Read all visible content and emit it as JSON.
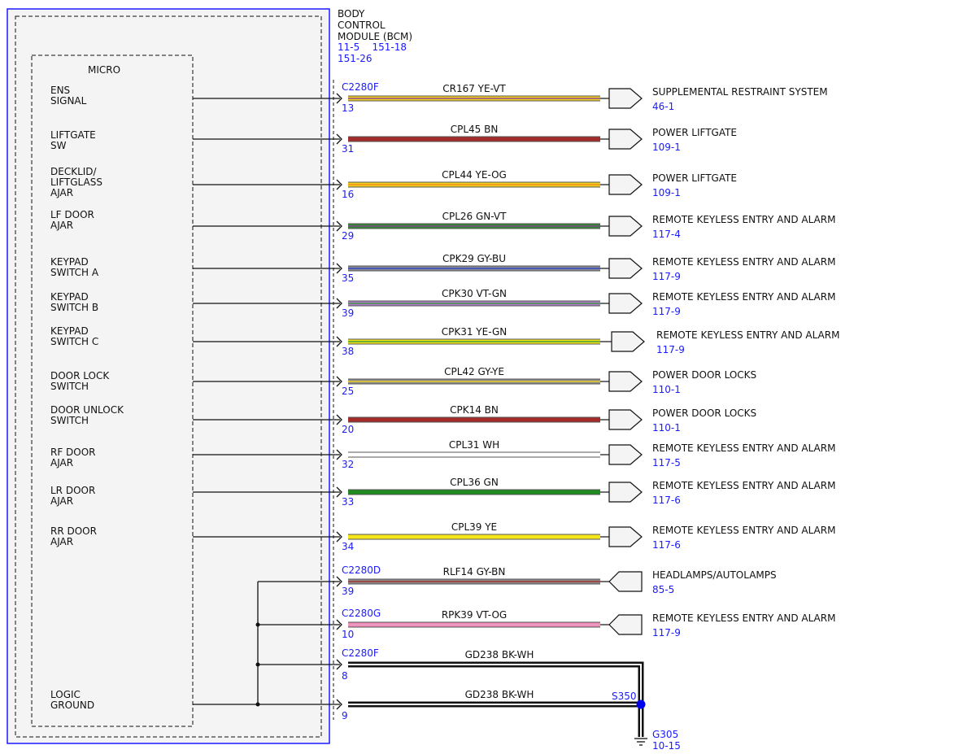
{
  "module": {
    "title_lines": [
      "BODY",
      "CONTROL",
      "MODULE (BCM)"
    ],
    "refs_line1": "11-5    151-18",
    "refs_line2": "151-26",
    "micro_label": "MICRO"
  },
  "colors": {
    "module_border": "#1a1aff",
    "module_fill": "#f4f4f4",
    "ref_text": "#1a1aff",
    "splice_dot": "#0000ee"
  },
  "circuits": [
    {
      "input": [
        "ENS",
        "SIGNAL"
      ],
      "connector": "C2280F",
      "pin": "13",
      "circuit": "CR167",
      "wire_color": "YE-VT",
      "colors": [
        "#f2d21b",
        "#8a3f9c"
      ],
      "dest": "SUPPLEMENTAL RESTRAINT SYSTEM",
      "dest_ref": "46-1"
    },
    {
      "input": [
        "LIFTGATE",
        "SW"
      ],
      "connector": "",
      "pin": "31",
      "circuit": "CPL45",
      "wire_color": "BN",
      "colors": [
        "#a52a2a"
      ],
      "dest": "POWER LIFTGATE",
      "dest_ref": "109-1"
    },
    {
      "input": [
        "DECKLID/",
        "LIFTGLASS",
        "AJAR"
      ],
      "connector": "",
      "pin": "16",
      "circuit": "CPL44",
      "wire_color": "YE-OG",
      "colors": [
        "#f2d21b",
        "#f08a1c"
      ],
      "dest": "POWER LIFTGATE",
      "dest_ref": "109-1"
    },
    {
      "input": [
        "LF DOOR",
        "AJAR"
      ],
      "connector": "",
      "pin": "29",
      "circuit": "CPL26",
      "wire_color": "GN-VT",
      "colors": [
        "#2f8a2f",
        "#8a3f9c"
      ],
      "dest": "REMOTE KEYLESS ENTRY AND ALARM",
      "dest_ref": "117-4"
    },
    {
      "input": [
        "KEYPAD",
        "SWITCH A"
      ],
      "connector": "",
      "pin": "35",
      "circuit": "CPK29",
      "wire_color": "GY-BU",
      "colors": [
        "#8c8c8c",
        "#2b3fd6"
      ],
      "dest": "REMOTE KEYLESS ENTRY AND ALARM",
      "dest_ref": "117-9"
    },
    {
      "input": [
        "KEYPAD",
        "SWITCH B"
      ],
      "connector": "",
      "pin": "39",
      "circuit": "CPK30",
      "wire_color": "VT-GN",
      "colors": [
        "#b07cc6",
        "#3a9a3a"
      ],
      "dest": "REMOTE KEYLESS ENTRY AND ALARM",
      "dest_ref": "117-9"
    },
    {
      "input": [
        "KEYPAD",
        "SWITCH C"
      ],
      "connector": "",
      "pin": "38",
      "circuit": "CPK31",
      "wire_color": "YE-GN",
      "colors": [
        "#f2e21b",
        "#3a9a3a"
      ],
      "dest": "REMOTE KEYLESS ENTRY AND ALARM",
      "dest_ref": "117-9"
    },
    {
      "input": [
        "DOOR LOCK",
        "SWITCH"
      ],
      "connector": "",
      "pin": "25",
      "circuit": "CPL42",
      "wire_color": "GY-YE",
      "colors": [
        "#8c8c8c",
        "#f2d21b"
      ],
      "dest": "POWER DOOR LOCKS",
      "dest_ref": "110-1"
    },
    {
      "input": [
        "DOOR UNLOCK",
        "SWITCH"
      ],
      "connector": "",
      "pin": "20",
      "circuit": "CPK14",
      "wire_color": "BN",
      "colors": [
        "#a52a2a"
      ],
      "dest": "POWER DOOR LOCKS",
      "dest_ref": "110-1"
    },
    {
      "input": [
        "RF DOOR",
        "AJAR"
      ],
      "connector": "",
      "pin": "32",
      "circuit": "CPL31",
      "wire_color": "WH",
      "colors": [
        "#ffffff"
      ],
      "dest": "REMOTE KEYLESS ENTRY AND ALARM",
      "dest_ref": "117-5"
    },
    {
      "input": [
        "LR DOOR",
        "AJAR"
      ],
      "connector": "",
      "pin": "33",
      "circuit": "CPL36",
      "wire_color": "GN",
      "colors": [
        "#1f8a1f"
      ],
      "dest": "REMOTE KEYLESS ENTRY AND ALARM",
      "dest_ref": "117-6"
    },
    {
      "input": [
        "RR DOOR",
        "AJAR"
      ],
      "connector": "",
      "pin": "34",
      "circuit": "CPL39",
      "wire_color": "YE",
      "colors": [
        "#f5e61b"
      ],
      "dest": "REMOTE KEYLESS ENTRY AND ALARM",
      "dest_ref": "117-6"
    },
    {
      "input": [],
      "connector": "C2280D",
      "pin": "39",
      "circuit": "RLF14",
      "wire_color": "GY-BN",
      "colors": [
        "#8c8c8c",
        "#a52a2a"
      ],
      "dest": "HEADLAMPS/AUTOLAMPS",
      "dest_ref": "85-5"
    },
    {
      "input": [],
      "connector": "C2280G",
      "pin": "10",
      "circuit": "RPK39",
      "wire_color": "VT-OG",
      "colors": [
        "#f08cb4",
        "#e8a0c8"
      ],
      "dest": "REMOTE KEYLESS ENTRY AND ALARM",
      "dest_ref": "117-9"
    }
  ],
  "grounds": [
    {
      "connector": "C2280F",
      "pin": "8",
      "circuit": "GD238",
      "wire_color": "BK-WH"
    },
    {
      "connector": "",
      "pin": "9",
      "circuit": "GD238",
      "wire_color": "BK-WH"
    }
  ],
  "logic_ground": [
    "LOGIC",
    "GROUND"
  ],
  "splice": {
    "label": "S350"
  },
  "ground_point": {
    "label": "G305",
    "ref": "10-15"
  }
}
